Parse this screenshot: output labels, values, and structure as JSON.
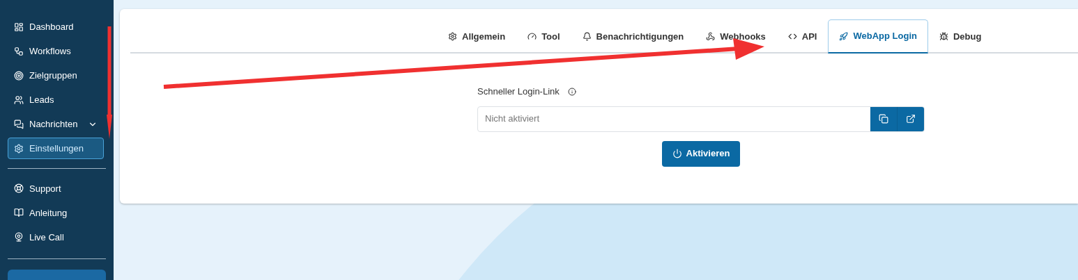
{
  "sidebar": {
    "main_items": [
      {
        "label": "Dashboard",
        "selected": false
      },
      {
        "label": "Workflows",
        "selected": false
      },
      {
        "label": "Zielgruppen",
        "selected": false
      },
      {
        "label": "Leads",
        "selected": false
      },
      {
        "label": "Nachrichten",
        "selected": false,
        "expandable": true
      },
      {
        "label": "Einstellungen",
        "selected": true
      }
    ],
    "help_items": [
      {
        "label": "Support",
        "selected": false
      },
      {
        "label": "Anleitung",
        "selected": false
      },
      {
        "label": "Live Call",
        "selected": false
      }
    ]
  },
  "tabs": [
    {
      "label": "Allgemein",
      "selected": false
    },
    {
      "label": "Tool",
      "selected": false
    },
    {
      "label": "Benachrichtigungen",
      "selected": false
    },
    {
      "label": "Webhooks",
      "selected": false
    },
    {
      "label": "API",
      "selected": false
    },
    {
      "label": "WebApp Login",
      "selected": true
    },
    {
      "label": "Debug",
      "selected": false
    }
  ],
  "login_link": {
    "label": "Schneller Login-Link",
    "placeholder": "Nicht aktiviert",
    "button": "Aktivieren"
  }
}
